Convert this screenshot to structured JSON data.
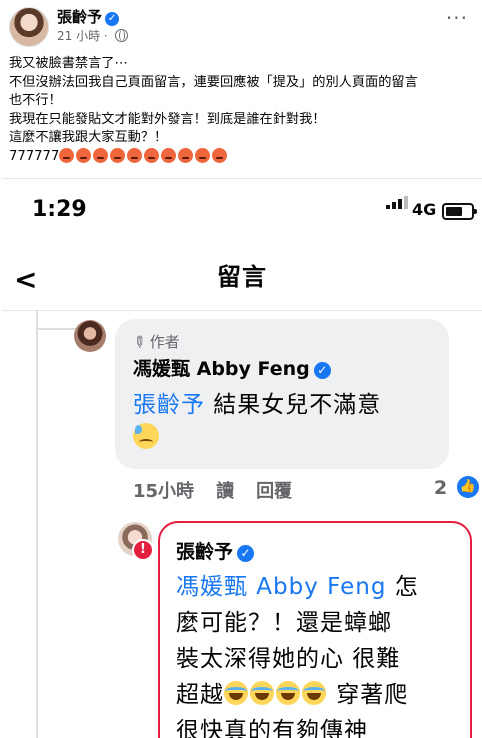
{
  "post": {
    "author": "張齡予",
    "time": "21 小時",
    "more": "···",
    "lines": [
      "我又被臉書禁言了⋯",
      "不但沒辦法回我自己頁面留言，連要回應被「提及」的別人頁面的留言",
      "也不行！",
      "我現在只能發貼文才能對外發言！到底是誰在針對我！",
      "這麼不讓我跟大家互動？！"
    ],
    "last_line_text": "777777",
    "angry_emoji_count": 10
  },
  "screenshot": {
    "status_time": "1:29",
    "network": "4G",
    "nav_title": "留言",
    "back": "<",
    "comment1": {
      "author_tag": "作者",
      "name": "馮媛甄 Abby Feng",
      "mention": "張齡予",
      "text": " 結果女兒不滿意",
      "emoji": "sad-sweat-emoji"
    },
    "actions": {
      "time": "15小時",
      "read": "讀",
      "reply": "回覆",
      "likes": "2"
    },
    "comment2": {
      "name": "張齡予",
      "mention": "馮媛甄 Abby Feng",
      "line1_suffix": " 怎",
      "line2": "麼可能？！還是蟑螂",
      "line3": "裝太深得她的心 很難",
      "line4_prefix": "超越",
      "line4_suffix": " 穿著爬",
      "line5": "很快真的有夠傳神"
    }
  },
  "colors": {
    "facebook_blue": "#1877f2",
    "error_red": "#e41e3f",
    "meta_gray": "#65676b",
    "bubble_gray": "#eef0f2"
  }
}
